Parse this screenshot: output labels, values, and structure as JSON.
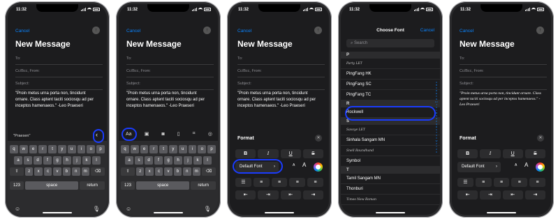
{
  "status": {
    "time": "11:32"
  },
  "compose": {
    "cancel": "Cancel",
    "title": "New Message",
    "to": "To:",
    "cc": "Cc/Bcc, From:",
    "subject": "Subject:",
    "body": "\"Proin metus urna porta non, tincidunt ornare. Class aptent taciti sociosqu ad per inceptos hamenaeos.\" -Leo Praeseri",
    "body_italic": "\"Proin metus urna porta non, tincidunt ornare. Class aptent taciti sociosqu ad per inceptos hamenaeos.\" -Leo Praeseri"
  },
  "keyboard": {
    "suggestion": "\"Praesen\"",
    "row1": [
      "q",
      "w",
      "e",
      "r",
      "t",
      "y",
      "u",
      "i",
      "o",
      "p"
    ],
    "row2": [
      "a",
      "s",
      "d",
      "f",
      "g",
      "h",
      "j",
      "k",
      "l"
    ],
    "row3": [
      "z",
      "x",
      "c",
      "v",
      "b",
      "n",
      "m"
    ],
    "num": "123",
    "space": "space",
    "return": "return"
  },
  "toolbar": {
    "aa": "Aa"
  },
  "format": {
    "title": "Format",
    "bold": "B",
    "italic": "I",
    "underline": "U",
    "strike": "S",
    "font": "Default Font",
    "small_a": "A",
    "large_a": "A"
  },
  "picker": {
    "title": "Choose Font",
    "cancel": "Cancel",
    "search": "Search",
    "sections": [
      {
        "letter": "P",
        "items": [
          "Party LET",
          "PingFang HK",
          "PingFang SC",
          "PingFang TC"
        ]
      },
      {
        "letter": "R",
        "items": [
          "Rockwell"
        ]
      },
      {
        "letter": "S",
        "items": [
          "Savoye LET",
          "Sinhala Sangam MN",
          "Snell Roundhand",
          "Symbol"
        ]
      },
      {
        "letter": "T",
        "items": [
          "Tamil Sangam MN",
          "Thonburi",
          "Times New Roman"
        ]
      }
    ],
    "index": "A B C D E F G H I J K L M N O P Q R S T U V W Z Y Z #"
  },
  "colors": {
    "accent": "#0a84ff",
    "highlight": "#1a3cff"
  }
}
